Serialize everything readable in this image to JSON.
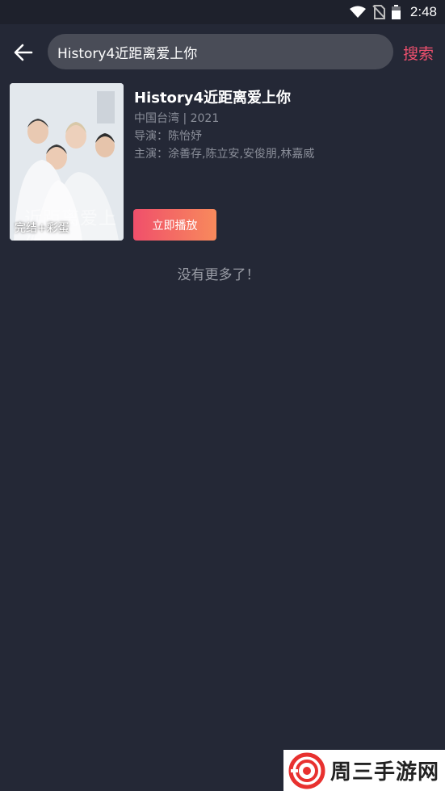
{
  "status": {
    "time": "2:48"
  },
  "search": {
    "query": "History4近距离爱上你",
    "button_label": "搜索"
  },
  "result": {
    "title": "History4近距离爱上你",
    "region_year": "中国台湾 | 2021",
    "director": "导演：陈怡妤",
    "cast": "主演：涂善存,陈立安,安俊朋,林嘉威",
    "badge": "完结+彩蛋",
    "poster_text": "近距离爱上你",
    "play_label": "立即播放"
  },
  "footer_text": "没有更多了！",
  "watermark": {
    "text": "周三手游网"
  },
  "colors": {
    "background": "#242836",
    "accent": "#f0506e"
  }
}
